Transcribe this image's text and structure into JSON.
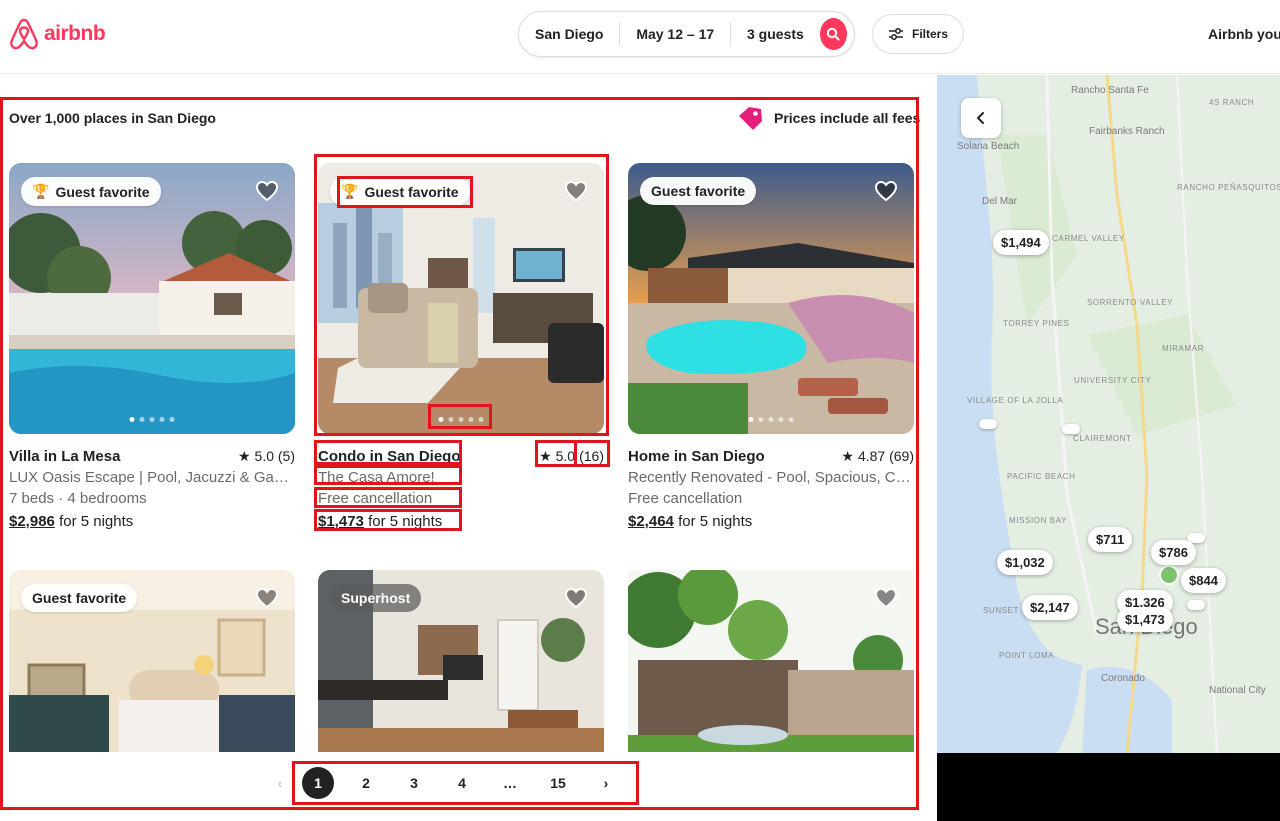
{
  "header": {
    "logo_text": "airbnb",
    "search": {
      "location": "San Diego",
      "dates": "May 12 – 17",
      "guests": "3 guests"
    },
    "filters_label": "Filters",
    "host_link": "Airbnb you"
  },
  "results": {
    "count_text": "Over 1,000 places in San Diego",
    "prices_note": "Prices include all fees"
  },
  "listings": [
    {
      "badge": "Guest favorite",
      "title": "Villa in La Mesa",
      "rating": "5.0 (5)",
      "subtitle": "LUX Oasis Escape | Pool, Jacuzzi & Game Room",
      "detail": "7 beds · 4 bedrooms",
      "price": "$2,986",
      "price_suffix": "for 5 nights"
    },
    {
      "badge": "Guest favorite",
      "title": "Condo in San Diego",
      "rating_value": "5.0",
      "rating_count": "(16)",
      "subtitle": "The Casa Amore!",
      "detail": "Free cancellation",
      "price": "$1,473",
      "price_suffix": "for 5 nights"
    },
    {
      "badge": "Guest favorite",
      "title": "Home in San Diego",
      "rating": "4.87 (69)",
      "subtitle": "Recently Renovated - Pool, Spacious, Central",
      "detail": "Free cancellation",
      "price": "$2,464",
      "price_suffix": "for 5 nights"
    },
    {
      "badge": "Guest favorite"
    },
    {
      "badge": "Superhost"
    },
    {}
  ],
  "pagination": {
    "pages": [
      "1",
      "2",
      "3",
      "4",
      "…",
      "15"
    ],
    "current": "1"
  },
  "map": {
    "places": [
      "Rancho Santa Fe",
      "4S RANCH",
      "Solana Beach",
      "Fairbanks Ranch",
      "Del Mar",
      "RANCHO PEÑASQUITOS",
      "CARMEL VALLEY",
      "SORRENTO VALLEY",
      "TORREY PINES",
      "MIRAMAR",
      "UNIVERSITY CITY",
      "VILLAGE OF LA JOLLA",
      "CLAIREMONT",
      "PACIFIC BEACH",
      "MISSION BAY",
      "San Diego",
      "SUNSET CLIFFS",
      "POINT LOMA",
      "Coronado",
      "National City"
    ],
    "prices": [
      "$1,494",
      "$711",
      "$786",
      "$1,032",
      "$844",
      "$2,147",
      "$1,326",
      "$1,473"
    ]
  },
  "colors": {
    "brand": "#ff385c",
    "annotation": "#e0141b"
  }
}
